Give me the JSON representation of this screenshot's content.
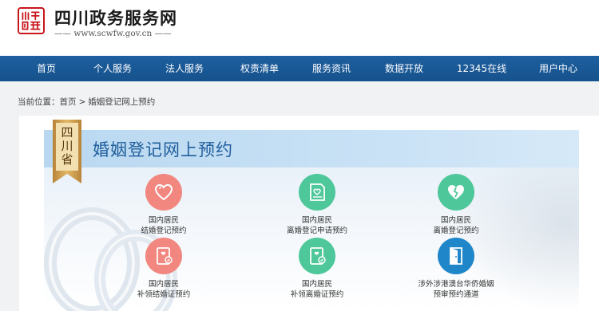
{
  "header": {
    "logo_text": "四川省",
    "site_title": "四川政务服务网",
    "site_url": "—— www.scwfw.gov.cn ——"
  },
  "nav": {
    "items": [
      {
        "label": "首页"
      },
      {
        "label": "个人服务"
      },
      {
        "label": "法人服务"
      },
      {
        "label": "权责清单"
      },
      {
        "label": "服务资讯"
      },
      {
        "label": "数据开放"
      },
      {
        "label": "12345在线"
      },
      {
        "label": "用户中心"
      }
    ]
  },
  "breadcrumb": {
    "prefix": "当前位置：",
    "home": "首页",
    "separator": ">",
    "current": "婚姻登记网上预约"
  },
  "banner": {
    "ribbon_chars": [
      "四",
      "川",
      "省"
    ],
    "title": "婚姻登记网上预约"
  },
  "services": [
    {
      "line1": "国内居民",
      "line2": "结婚登记预约",
      "icon": "heart-icon",
      "color": "#f1877f"
    },
    {
      "line1": "国内居民",
      "line2": "离婚登记申请预约",
      "icon": "document-heart-icon",
      "color": "#4ec79a"
    },
    {
      "line1": "国内居民",
      "line2": "离婚登记预约",
      "icon": "broken-heart-icon",
      "color": "#4ec79a"
    },
    {
      "line1": "国内居民",
      "line2": "补领结婚证预约",
      "icon": "certificate-icon",
      "color": "#f1877f"
    },
    {
      "line1": "国内居民",
      "line2": "补领离婚证预约",
      "icon": "certificate-icon",
      "color": "#4ec79a"
    },
    {
      "line1": "涉外涉港澳台华侨婚姻",
      "line2": "预审预约通道",
      "icon": "door-icon",
      "color": "#1f87c9"
    }
  ],
  "colors": {
    "nav_bg": "#1a5896",
    "accent_red": "#c8161d",
    "banner_title": "#1f5e9c"
  }
}
